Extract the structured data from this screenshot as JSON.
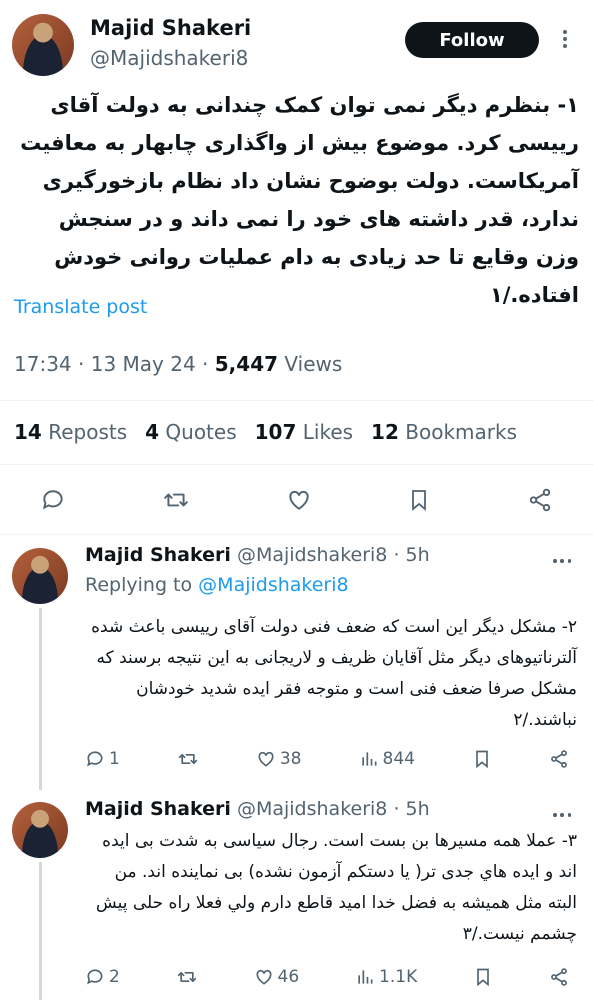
{
  "main_tweet": {
    "name": "Majid Shakeri",
    "handle": "@Majidshakeri8",
    "follow_label": "Follow",
    "text": "۱- بنظرم دیگر نمی توان کمک چندانی به دولت آقای رییسی کرد. موضوع بیش از واگذاری چابهار به معافیت آمریکاست. دولت بوضوح نشان داد نظام بازخورگیری ندارد، قدر داشته های خود را نمی داند و در سنجش وزن وقایع تا حد زیادی به دام عملیات روانی خودش افتاده./۱",
    "translate_label": "Translate post",
    "time": "17:34",
    "date": "13 May 24",
    "views_count": "5,447",
    "views_label": "Views",
    "stats": [
      {
        "count": "14",
        "label": "Reposts"
      },
      {
        "count": "4",
        "label": "Quotes"
      },
      {
        "count": "107",
        "label": "Likes"
      },
      {
        "count": "12",
        "label": "Bookmarks"
      }
    ]
  },
  "replies": [
    {
      "name": "Majid Shakeri",
      "handle": "@Majidshakeri8",
      "age": "· 5h",
      "replying_prefix": "Replying to",
      "replying_handle": "@Majidshakeri8",
      "text": "۲- مشکل دیگر این است که ضعف فنی دولت آقای رییسی باعث شده آلترناتیوهای دیگر مثل آقایان ظریف و لاریجانی به این نتیجه برسند که مشکل صرفا ضعف فنی است و متوجه فقر ایده شدید خودشان نباشند./۲",
      "replies": "1",
      "reposts": "",
      "likes": "38",
      "views": "844"
    },
    {
      "name": "Majid Shakeri",
      "handle": "@Majidshakeri8",
      "age": "· 5h",
      "text": "۳- عملا همه مسیرها بن بست است. رجال سیاسی به شدت بی ایده اند و ایده هاي جدی تر( یا دستکم آزمون نشده) بی نماینده اند. من البته مثل همیشه به فضل خدا امید قاطع دارم ولي فعلا راه حلی پیش چشمم نیست./۳",
      "replies": "2",
      "reposts": "",
      "likes": "46",
      "views": "1.1K"
    }
  ]
}
